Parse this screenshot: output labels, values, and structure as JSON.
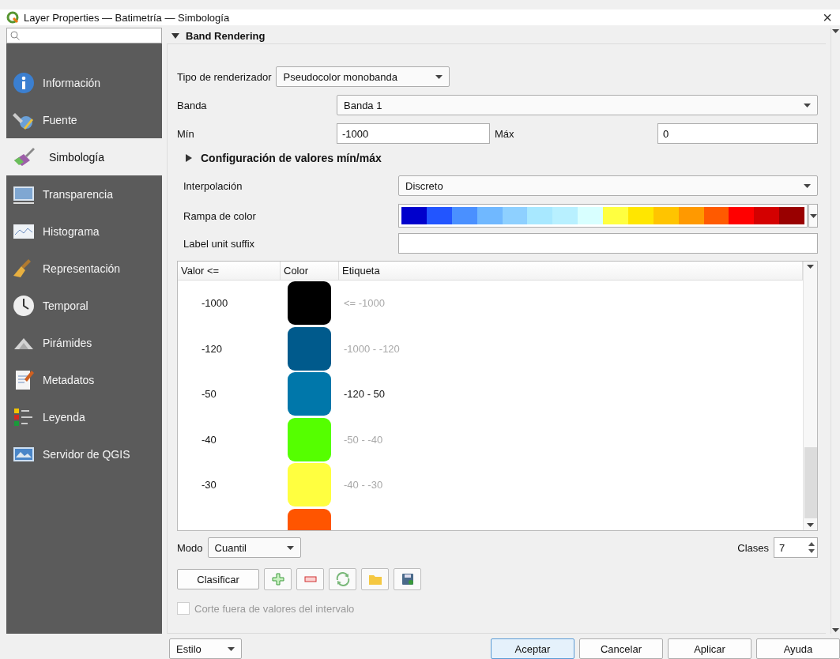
{
  "window": {
    "title": "Layer Properties — Batimetría — Simbología",
    "close": "×"
  },
  "sidebar": {
    "items": [
      {
        "label": "Información",
        "selected": false
      },
      {
        "label": "Fuente",
        "selected": false
      },
      {
        "label": "Simbología",
        "selected": true
      },
      {
        "label": "Transparencia",
        "selected": false
      },
      {
        "label": "Histograma",
        "selected": false
      },
      {
        "label": "Representación",
        "selected": false
      },
      {
        "label": "Temporal",
        "selected": false
      },
      {
        "label": "Pirámides",
        "selected": false
      },
      {
        "label": "Metadatos",
        "selected": false
      },
      {
        "label": "Leyenda",
        "selected": false
      },
      {
        "label": "Servidor de QGIS",
        "selected": false
      }
    ]
  },
  "band_rendering": {
    "title": "Band Rendering",
    "expanded": true,
    "renderer": {
      "label": "Tipo de renderizador",
      "value": "Pseudocolor monobanda"
    },
    "band": {
      "label": "Banda",
      "value": "Banda 1"
    },
    "min": {
      "label": "Mín",
      "value": "-1000"
    },
    "max": {
      "label": "Máx",
      "value": "0"
    },
    "minmax_settings": {
      "title": "Configuración de valores mín/máx",
      "expanded": false
    },
    "interpolation": {
      "label": "Interpolación",
      "value": "Discreto"
    },
    "color_ramp": {
      "label": "Rampa de color"
    },
    "unit_suffix": {
      "label": "Label unit suffix"
    },
    "table": {
      "columns": [
        "Valor <=",
        "Color",
        "Etiqueta"
      ],
      "rows": [
        {
          "value": "-1000",
          "color": "#000000",
          "label": "<= -1000",
          "muted": true
        },
        {
          "value": "-120",
          "color": "#005a8c",
          "label": "-1000 - -120",
          "muted": true
        },
        {
          "value": "-50",
          "color": "#0077aa",
          "label": "-120 - 50",
          "muted": false
        },
        {
          "value": "-40",
          "color": "#55ff00",
          "label": "-50 - -40",
          "muted": true
        },
        {
          "value": "-30",
          "color": "#ffff40",
          "label": "-40 - -30",
          "muted": true
        },
        {
          "color": "#ff5500"
        }
      ]
    },
    "mode": {
      "label": "Modo",
      "value": "Cuantil"
    },
    "classes": {
      "label": "Clases",
      "value": "7"
    },
    "classify_button": "Clasificar",
    "clip": {
      "label": "Corte fuera de valores del intervalo",
      "checked": false,
      "disabled": true
    }
  },
  "footer": {
    "style_button": "Estilo",
    "buttons": [
      {
        "label": "Aceptar",
        "default": true
      },
      {
        "label": "Cancelar",
        "default": false
      },
      {
        "label": "Aplicar",
        "default": false
      },
      {
        "label": "Ayuda",
        "default": false
      }
    ]
  }
}
